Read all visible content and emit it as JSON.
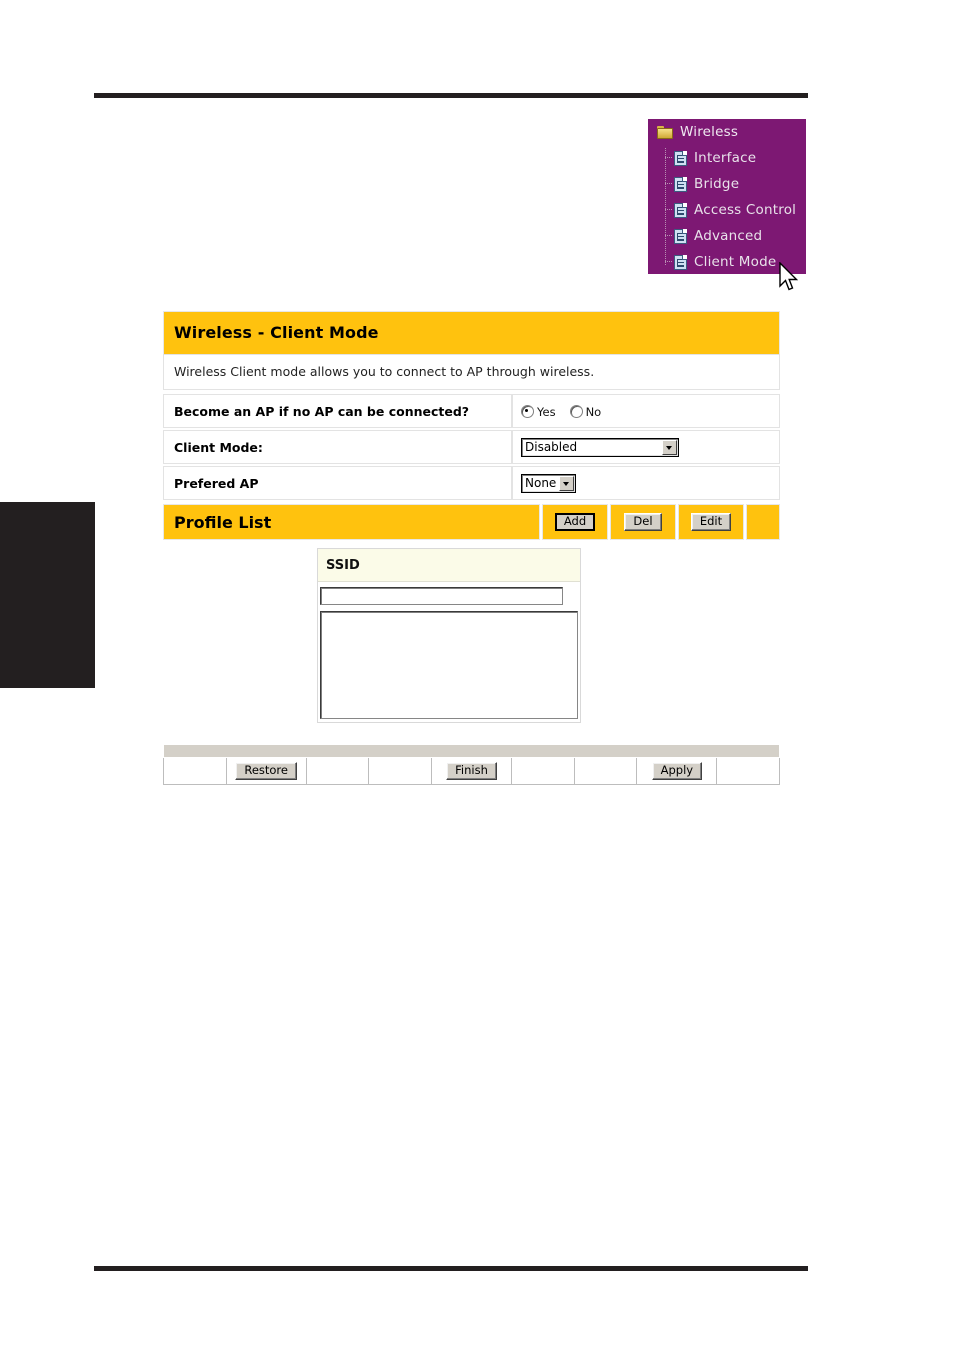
{
  "nav_menu": {
    "root": {
      "label": "Wireless",
      "icon": "folder-icon"
    },
    "items": [
      {
        "label": "Interface",
        "icon": "page-icon"
      },
      {
        "label": "Bridge",
        "icon": "page-icon"
      },
      {
        "label": "Access Control",
        "icon": "page-icon"
      },
      {
        "label": "Advanced",
        "icon": "page-icon"
      },
      {
        "label": "Client Mode",
        "icon": "page-icon"
      }
    ],
    "background_color": "#7d1873",
    "text_color": "#e8e2ea"
  },
  "cursor": {
    "icon": "mouse-pointer-icon"
  },
  "panel": {
    "title": "Wireless - Client Mode",
    "description": "Wireless Client mode allows you to connect to AP through wireless.",
    "header_color": "#ffc20e",
    "rows": [
      {
        "label": "Become an AP if no AP can be connected?",
        "control": "radio",
        "options": [
          {
            "label": "Yes",
            "selected": true
          },
          {
            "label": "No",
            "selected": false
          }
        ]
      },
      {
        "label": "Client Mode:",
        "control": "select",
        "value": "Disabled"
      },
      {
        "label": "Prefered AP",
        "control": "select",
        "value": "None"
      }
    ]
  },
  "profile_list": {
    "title": "Profile List",
    "buttons": [
      {
        "label": "Add",
        "default": true
      },
      {
        "label": "Del",
        "default": false
      },
      {
        "label": "Edit",
        "default": false
      }
    ]
  },
  "ssid_panel": {
    "header": "SSID",
    "input_value": "",
    "input_placeholder": "",
    "list_items": []
  },
  "action_bar": {
    "buttons": [
      {
        "label": "Restore"
      },
      {
        "label": "Finish"
      },
      {
        "label": "Apply"
      }
    ]
  }
}
